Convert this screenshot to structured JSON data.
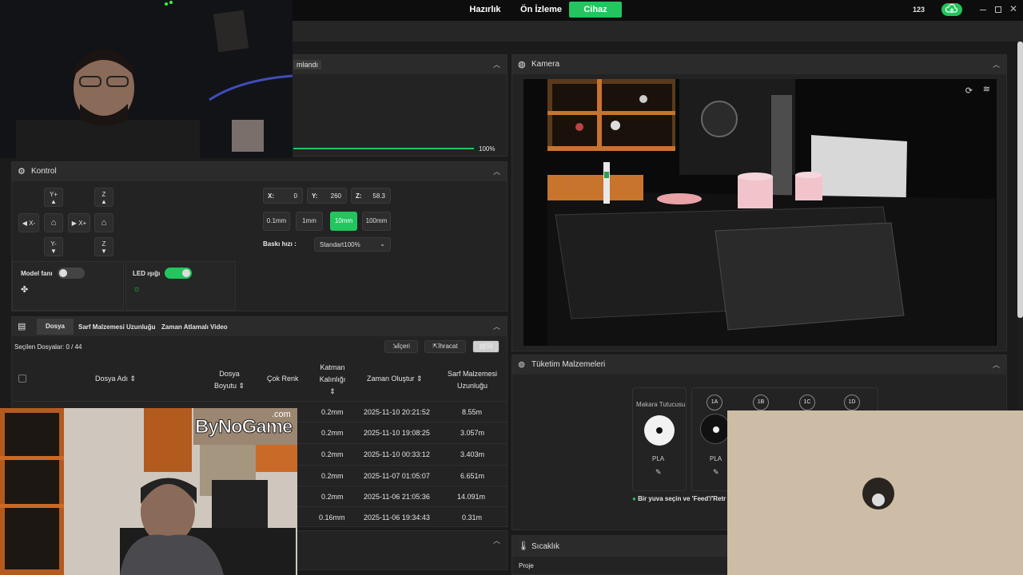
{
  "topbar": {
    "tabs": [
      {
        "label": "Hazırlık",
        "active": false
      },
      {
        "label": "Ön İzleme",
        "active": false
      },
      {
        "label": "Cihaz",
        "active": true
      }
    ],
    "user_label": "123",
    "accent": "#22c55e"
  },
  "status_panel": {
    "title_partial": "mlandı",
    "progress_percent": 100,
    "progress_label": "100%"
  },
  "control": {
    "title": "Kontrol",
    "jog": {
      "y_plus": "Y+",
      "y_minus": "Y-",
      "x_minus": "X-",
      "x_plus": "X+",
      "z_up": "Z",
      "z_down": "Z"
    },
    "coords": {
      "x_label": "X:",
      "x_value": "0",
      "y_label": "Y:",
      "y_value": "260",
      "z_label": "Z:",
      "z_value": "58.3"
    },
    "steps": [
      "0.1mm",
      "1mm",
      "10mm",
      "100mm"
    ],
    "active_step": "10mm",
    "speed_label": "Baskı hızı :",
    "speed_value": "Standart100%",
    "model_fan_label": "Model fanı",
    "model_fan_on": false,
    "led_label": "LED ışığı",
    "led_on": true
  },
  "files": {
    "tabs": [
      "Dosya",
      "Sarf Malzemesi Uzunluğu",
      "Zaman Atlamalı Video"
    ],
    "selected_label": "Seçilen Dosyalar: 0 / 44",
    "import_label": "İçeri",
    "export_label": "İhracat",
    "delete_label": "Sil",
    "headers": {
      "name": "Dosya Adı",
      "size_1": "Dosya",
      "size_2": "Boyutu",
      "multicolor": "Çok Renk",
      "layer_1": "Katman",
      "layer_2": "Kalınlığı",
      "created": "Zaman Oluştur",
      "filament_1": "Sarf Malzemesi",
      "filament_2": "Uzunluğu"
    },
    "rows": [
      {
        "layer": "0.2mm",
        "created": "2025-11-10 20:21:52",
        "filament": "8.55m"
      },
      {
        "layer": "0.2mm",
        "created": "2025-11-10 19:08:25",
        "filament": "3.057m"
      },
      {
        "layer": "0.2mm",
        "created": "2025-11-10 00:33:12",
        "filament": "3.403m"
      },
      {
        "layer": "0.2mm",
        "created": "2025-11-07 01:05:07",
        "filament": "6.651m"
      },
      {
        "layer": "0.2mm",
        "created": "2025-11-06 21:05:36",
        "filament": "14.091m"
      },
      {
        "layer": "0.16mm",
        "created": "2025-11-06 19:34:43",
        "filament": "0.31m"
      }
    ]
  },
  "camera": {
    "title": "Kamera"
  },
  "consumables": {
    "title": "Tüketim Malzemeleri",
    "spool_holder_label": "Makara Tutucusu",
    "slots": [
      "1A",
      "1B",
      "1C",
      "1D"
    ],
    "material_1": "PLA",
    "material_2": "PLA",
    "hint": "Bir yuva seçin ve 'Feed'/'Retr"
  },
  "temperature": {
    "title": "Sıcaklık",
    "project_label": "Proje"
  },
  "overlay": {
    "brand": "ByNoGame",
    "brand_suffix": ".com"
  }
}
